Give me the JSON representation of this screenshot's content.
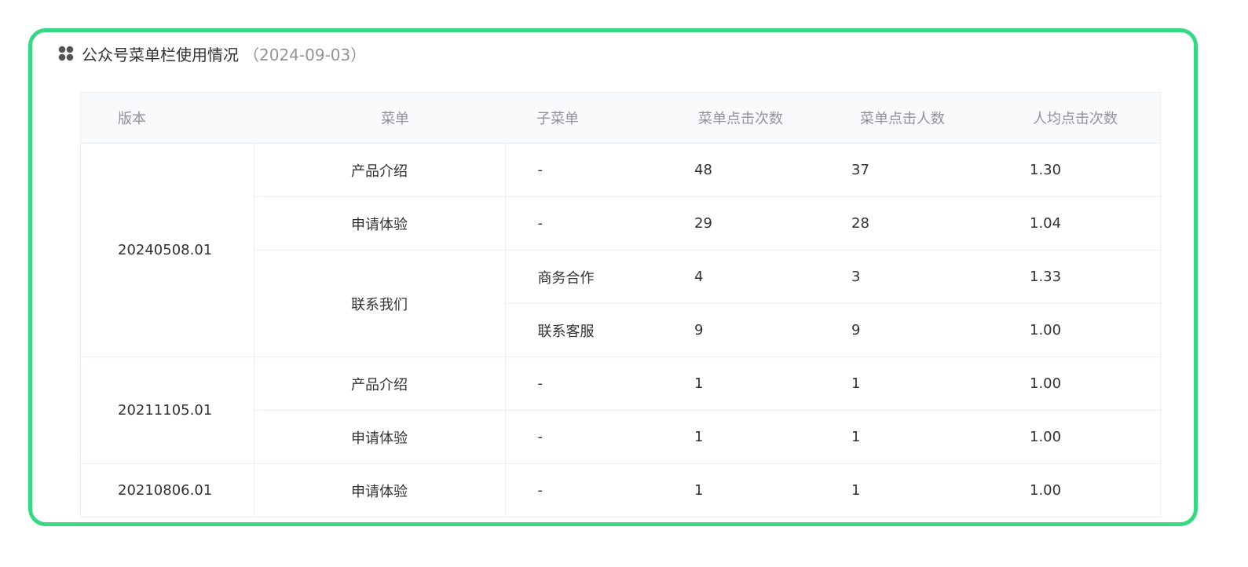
{
  "header": {
    "title": "公众号菜单栏使用情况",
    "date": "（2024-09-03）",
    "icon": "grid-four-icon"
  },
  "table": {
    "columns": [
      "版本",
      "菜单",
      "子菜单",
      "菜单点击次数",
      "菜单点击人数",
      "人均点击次数"
    ],
    "groups": [
      {
        "version": "20240508.01",
        "menus": [
          {
            "menu": "产品介绍",
            "rows": [
              {
                "sub": "-",
                "clicks": "48",
                "users": "37",
                "avg": "1.30"
              }
            ]
          },
          {
            "menu": "申请体验",
            "rows": [
              {
                "sub": "-",
                "clicks": "29",
                "users": "28",
                "avg": "1.04"
              }
            ]
          },
          {
            "menu": "联系我们",
            "rows": [
              {
                "sub": "商务合作",
                "clicks": "4",
                "users": "3",
                "avg": "1.33"
              },
              {
                "sub": "联系客服",
                "clicks": "9",
                "users": "9",
                "avg": "1.00"
              }
            ]
          }
        ]
      },
      {
        "version": "20211105.01",
        "menus": [
          {
            "menu": "产品介绍",
            "rows": [
              {
                "sub": "-",
                "clicks": "1",
                "users": "1",
                "avg": "1.00"
              }
            ]
          },
          {
            "menu": "申请体验",
            "rows": [
              {
                "sub": "-",
                "clicks": "1",
                "users": "1",
                "avg": "1.00"
              }
            ]
          }
        ]
      },
      {
        "version": "20210806.01",
        "menus": [
          {
            "menu": "申请体验",
            "rows": [
              {
                "sub": "-",
                "clicks": "1",
                "users": "1",
                "avg": "1.00"
              }
            ]
          }
        ]
      }
    ]
  },
  "colors": {
    "frame": "#34d982",
    "border": "#ebeef5",
    "header_bg": "#f9fafc",
    "muted_text": "#909399",
    "body_text": "#303133"
  }
}
